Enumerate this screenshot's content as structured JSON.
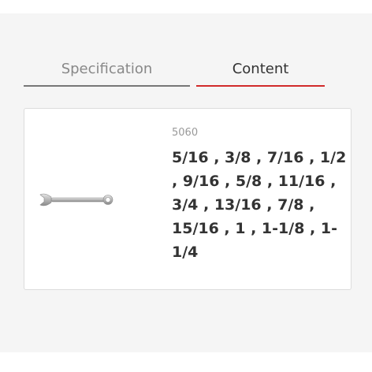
{
  "tabs": [
    {
      "label": "Specification"
    },
    {
      "label": "Content"
    }
  ],
  "active_tab": "Content",
  "product": {
    "image_icon": "combination-wrench-icon",
    "code": "5060",
    "sizes": "5/16 , 3/8 , 7/16 , 1/2 , 9/16 , 5/8 , 11/16 , 3/4 , 13/16 , 7/8 , 15/16 , 1 , 1-1/8 , 1-1/4"
  },
  "colors": {
    "active_tab_underline": "#d12a2a",
    "inactive_tab_underline": "#777777",
    "panel_background": "#f5f5f5"
  }
}
